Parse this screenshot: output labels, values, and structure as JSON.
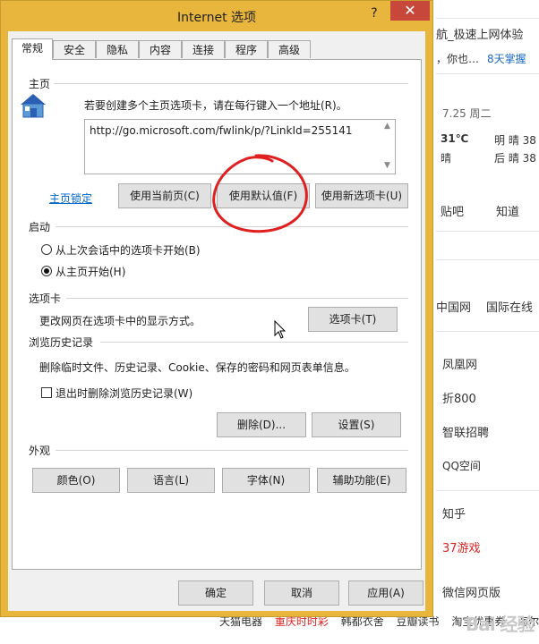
{
  "window": {
    "title": "Internet 选项",
    "help_glyph": "?",
    "close_glyph": "✕"
  },
  "tabs": [
    {
      "label": "常规",
      "active": true
    },
    {
      "label": "安全"
    },
    {
      "label": "隐私"
    },
    {
      "label": "内容"
    },
    {
      "label": "连接"
    },
    {
      "label": "程序"
    },
    {
      "label": "高级"
    }
  ],
  "homepage": {
    "section_title": "主页",
    "instruction": "若要创建多个主页选项卡，请在每行键入一个地址(R)。",
    "url": "http://go.microsoft.com/fwlink/p/?LinkId=255141",
    "lock_link": "主页锁定",
    "use_current": "使用当前页(C)",
    "use_default": "使用默认值(F)",
    "use_new_tab": "使用新选项卡(U)"
  },
  "startup": {
    "section_title": "启动",
    "option_last_session": "从上次会话中的选项卡开始(B)",
    "option_homepage": "从主页开始(H)",
    "selected": "option_homepage"
  },
  "tabs_section": {
    "section_title": "选项卡",
    "description": "更改网页在选项卡中的显示方式。",
    "button": "选项卡(T)"
  },
  "history": {
    "section_title": "浏览历史记录",
    "description": "删除临时文件、历史记录、Cookie、保存的密码和网页表单信息。",
    "checkbox_label": "退出时删除浏览历史记录(W)",
    "checkbox_checked": false,
    "delete_button": "删除(D)...",
    "settings_button": "设置(S)"
  },
  "appearance": {
    "section_title": "外观",
    "colors": "颜色(O)",
    "languages": "语言(L)",
    "fonts": "字体(N)",
    "accessibility": "辅助功能(E)"
  },
  "footer": {
    "ok": "确定",
    "cancel": "取消",
    "apply": "应用(A)"
  },
  "background": {
    "header_title": "航_极速上网体验",
    "header_sub": "，你也…",
    "header_badge": "8天掌握",
    "date": "7.25 周二",
    "temp": "31℃",
    "weather_today_label": "明 晴 38",
    "weather_now": "晴",
    "weather_next_label": "后 晴 38",
    "nav_1": "贴吧",
    "nav_2": "知道",
    "link_1": "中国网",
    "link_2": "国际在线",
    "list": [
      "凤凰网",
      "折800",
      "智联招聘",
      "QQ空间",
      "知乎",
      "37游戏",
      "微信网页版"
    ],
    "bottom_links": [
      "天猫电器",
      "重庆时时彩",
      "韩都衣舍",
      "豆瓣读书",
      "淘宝优惠券",
      "海尔电器"
    ],
    "watermark": "Bai 经验"
  },
  "colors": {
    "title_bar": "#e8b53d",
    "close_button": "#c7473a",
    "link": "#0066cc",
    "annotation": "#e02020"
  }
}
